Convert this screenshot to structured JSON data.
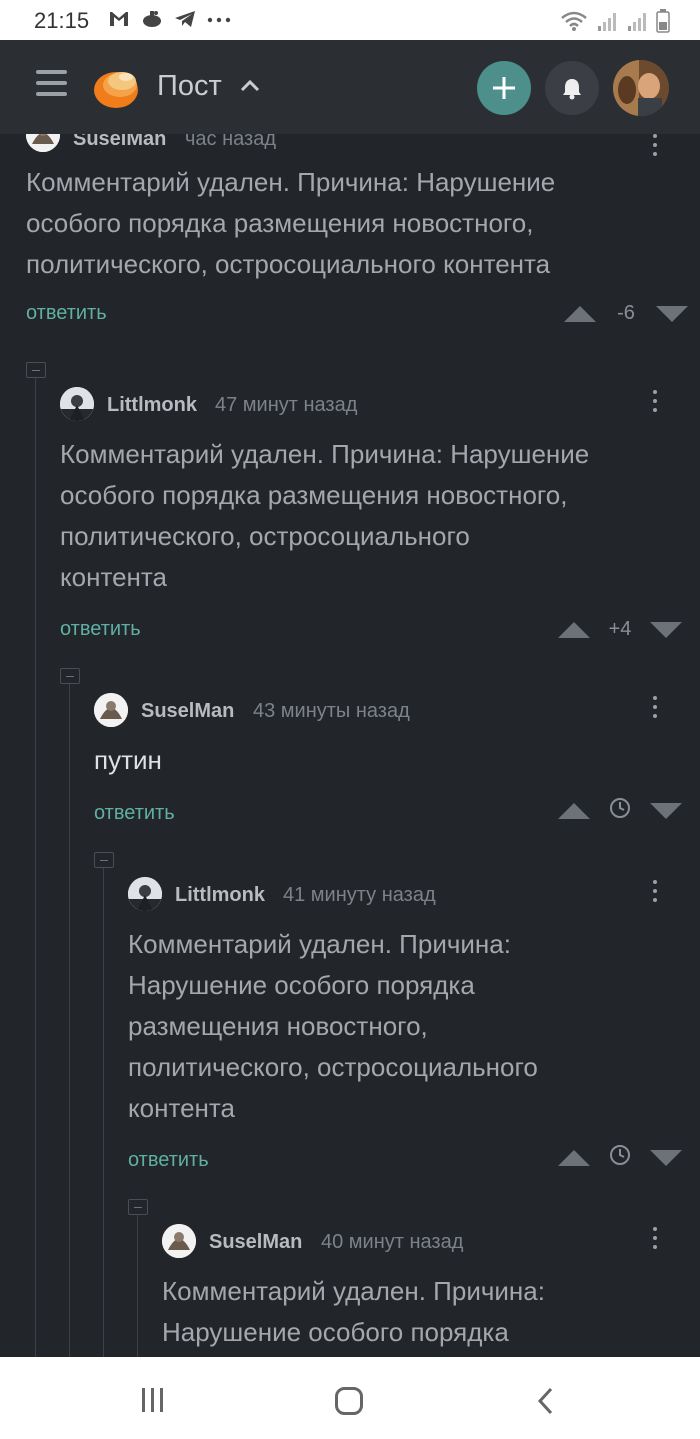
{
  "status_bar": {
    "time": "21:15"
  },
  "header": {
    "title": "Пост",
    "icons": [
      "menu-icon",
      "pikabu-logo",
      "chevron-up-icon",
      "plus-icon",
      "bell-icon",
      "user-avatar"
    ],
    "colors": {
      "background": "#2b2e33",
      "add_button": "#4d8f8a",
      "bell_button": "#3b3f45"
    }
  },
  "comments": [
    {
      "author": "SuselMan",
      "time": "час назад",
      "text": "Комментарий удален. Причина: Нарушение особого порядка размещения новостного, политического, остросоциального контента",
      "text_lines": [
        "Комментарий удален. Причина: Нарушение",
        "особого порядка размещения новостного,",
        "политического, остросоциального контента"
      ],
      "reply_label": "ответить",
      "score": "-6"
    },
    {
      "author": "Littlmonk",
      "time": "47 минут назад",
      "text": "Комментарий удален. Причина: Нарушение особого порядка размещения новостного, политического, остросоциального контента",
      "text_lines": [
        "Комментарий удален. Причина: Нарушение",
        "особого порядка размещения новостного,",
        "политического, остросоциального",
        "контента"
      ],
      "reply_label": "ответить",
      "score": "+4"
    },
    {
      "author": "SuselMan",
      "time": "43 минуты назад",
      "text": "путин",
      "text_lines": [
        "путин"
      ],
      "reply_label": "ответить",
      "score_icon": "clock-icon"
    },
    {
      "author": "Littlmonk",
      "time": "41 минуту назад",
      "text": "Комментарий удален. Причина: Нарушение особого порядка размещения новостного, политического, остросоциального контента",
      "text_lines": [
        "Комментарий удален. Причина:",
        "Нарушение особого порядка",
        "размещения новостного,",
        "политического, остросоциального",
        "контента"
      ],
      "reply_label": "ответить",
      "score_icon": "clock-icon"
    },
    {
      "author": "SuselMan",
      "time": "40 минут назад",
      "text": "Комментарий удален. Причина: Нарушение особого порядка",
      "text_lines": [
        "Комментарий удален. Причина:",
        "Нарушение особого порядка"
      ]
    }
  ],
  "nav_bar": {
    "icons": [
      "recent-apps-icon",
      "home-icon",
      "back-icon"
    ]
  },
  "colors": {
    "page_background": "#222529",
    "reply_link": "#5fb0a3",
    "deleted_text": "#a4a8ad",
    "normal_text": "#dfe1e4",
    "author": "#b8bcc1",
    "timestamp": "#7d8289"
  }
}
